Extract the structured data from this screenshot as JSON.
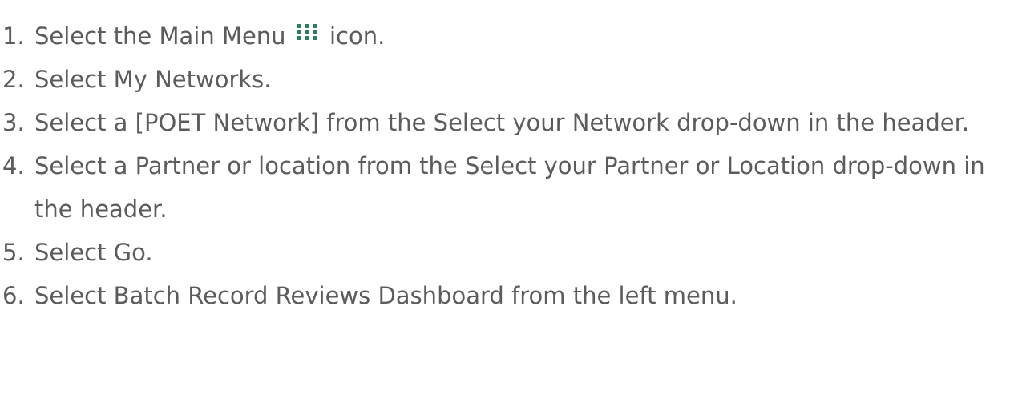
{
  "steps": [
    {
      "number": "1.",
      "before_icon": "Select the Main Menu",
      "icon": "grid-menu-icon",
      "after_icon": "icon."
    },
    {
      "number": "2.",
      "text": "Select My Networks."
    },
    {
      "number": "3.",
      "text": "Select a [POET Network] from the Select your Network drop-down in the header."
    },
    {
      "number": "4.",
      "text": "Select a Partner or location from the Select your Partner or Location drop-down in the header."
    },
    {
      "number": "5.",
      "text": "Select Go."
    },
    {
      "number": "6.",
      "text": "Select Batch Record Reviews Dashboard from the left menu."
    }
  ],
  "colors": {
    "text": "#5c5c5c",
    "icon": "#2e7d5b"
  }
}
